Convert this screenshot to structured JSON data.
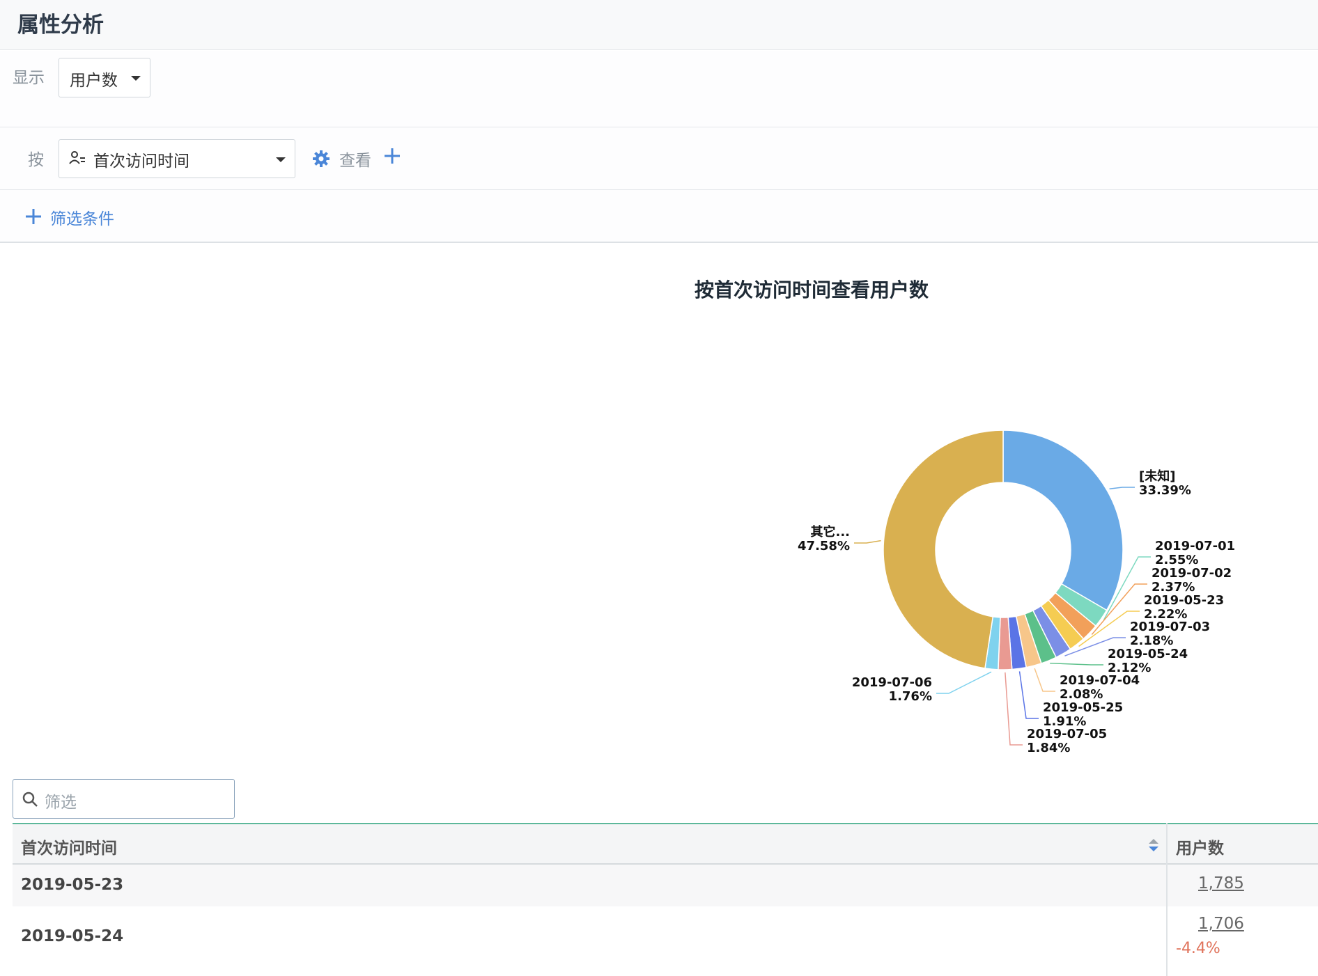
{
  "header": {
    "title": "属性分析"
  },
  "controls": {
    "display_label": "显示",
    "display_value": "用户数",
    "by_label": "按",
    "by_value": "首次访问时间",
    "view_label": "查看",
    "filter_label": "筛选条件"
  },
  "search": {
    "placeholder": "筛选"
  },
  "table": {
    "headers": [
      "首次访问时间",
      "用户数"
    ],
    "rows": [
      {
        "date": "2019-05-23",
        "value": "1,785",
        "change": ""
      },
      {
        "date": "2019-05-24",
        "value": "1,706",
        "change": "-4.4%"
      }
    ]
  },
  "chart_data": {
    "type": "pie",
    "donut": true,
    "title": "按首次访问时间查看用户数",
    "slices": [
      {
        "label": "[未知]",
        "percent": 33.39,
        "color": "#6aaae6"
      },
      {
        "label": "2019-07-01",
        "percent": 2.55,
        "color": "#7dd9c0"
      },
      {
        "label": "2019-07-02",
        "percent": 2.37,
        "color": "#f2a05a"
      },
      {
        "label": "2019-05-23",
        "percent": 2.22,
        "color": "#f5cc52"
      },
      {
        "label": "2019-07-03",
        "percent": 2.18,
        "color": "#7b8fe6"
      },
      {
        "label": "2019-05-24",
        "percent": 2.12,
        "color": "#5cc08a"
      },
      {
        "label": "2019-07-04",
        "percent": 2.08,
        "color": "#f7c68a"
      },
      {
        "label": "2019-05-25",
        "percent": 1.91,
        "color": "#5a74e6"
      },
      {
        "label": "2019-07-05",
        "percent": 1.84,
        "color": "#e99a92"
      },
      {
        "label": "2019-07-06",
        "percent": 1.76,
        "color": "#7fd2ee"
      },
      {
        "label": "其它...",
        "percent": 47.58,
        "color": "#d9b050"
      }
    ]
  }
}
